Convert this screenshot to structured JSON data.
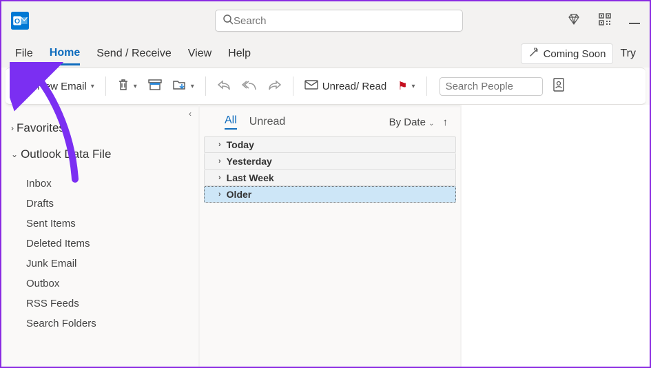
{
  "titlebar": {
    "search_placeholder": "Search"
  },
  "menubar": {
    "tabs": [
      {
        "label": "File"
      },
      {
        "label": "Home"
      },
      {
        "label": "Send / Receive"
      },
      {
        "label": "View"
      },
      {
        "label": "Help"
      }
    ],
    "coming_soon": "Coming Soon",
    "try": "Try"
  },
  "toolbar": {
    "new_email": "New Email",
    "unread_read": "Unread/ Read",
    "search_people_placeholder": "Search People"
  },
  "sidebar": {
    "favorites": "Favorites",
    "data_file": "Outlook Data File",
    "folders": [
      {
        "label": "Inbox"
      },
      {
        "label": "Drafts"
      },
      {
        "label": "Sent Items"
      },
      {
        "label": "Deleted Items"
      },
      {
        "label": "Junk Email"
      },
      {
        "label": "Outbox"
      },
      {
        "label": "RSS Feeds"
      },
      {
        "label": "Search Folders"
      }
    ]
  },
  "msglist": {
    "filter_all": "All",
    "filter_unread": "Unread",
    "sort_label": "By Date",
    "groups": [
      {
        "label": "Today"
      },
      {
        "label": "Yesterday"
      },
      {
        "label": "Last Week"
      },
      {
        "label": "Older"
      }
    ]
  }
}
